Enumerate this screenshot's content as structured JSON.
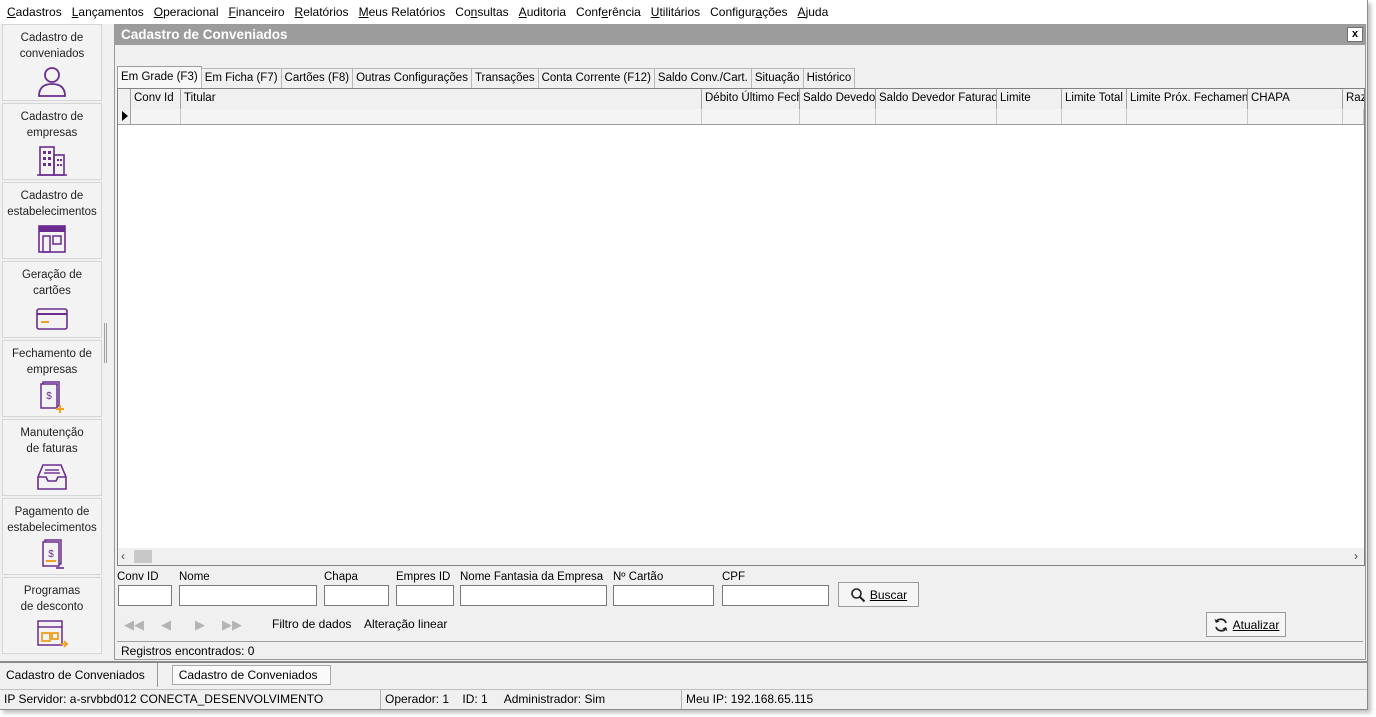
{
  "menu": [
    {
      "label": "Cadastros",
      "u": "C"
    },
    {
      "label": "Lançamentos",
      "u": "L"
    },
    {
      "label": "Operacional",
      "u": "O"
    },
    {
      "label": "Financeiro",
      "u": "F"
    },
    {
      "label": "Relatórios",
      "u": "R"
    },
    {
      "label": "Meus Relatórios",
      "u": "M"
    },
    {
      "label": "Consultas",
      "u": "n"
    },
    {
      "label": "Auditoria",
      "u": "A"
    },
    {
      "label": "Conferência",
      "u": "f"
    },
    {
      "label": "Utilitários",
      "u": "U"
    },
    {
      "label": "Configurações",
      "u": "g"
    },
    {
      "label": "Ajuda",
      "u": "A"
    }
  ],
  "sidebar": {
    "items": [
      {
        "label": "Cadastro de\nconveniados",
        "icon": "user-icon"
      },
      {
        "label": "Cadastro de\nempresas",
        "icon": "building-icon"
      },
      {
        "label": "Cadastro de\nestabelecimentos",
        "icon": "store-icon"
      },
      {
        "label": "Geração de\ncartões",
        "icon": "card-icon"
      },
      {
        "label": "Fechamento de\nempresas",
        "icon": "invoice-plus-icon"
      },
      {
        "label": "Manutenção\nde faturas",
        "icon": "inbox-tray-icon"
      },
      {
        "label": "Pagamento de\nestabelecimentos",
        "icon": "invoice-minus-icon"
      },
      {
        "label": "Programas\nde desconto",
        "icon": "discount-program-icon"
      }
    ]
  },
  "window": {
    "title": "Cadastro de Conveniados",
    "close_label": "x"
  },
  "tabs": [
    "Em Grade (F3)",
    "Em Ficha (F7)",
    "Cartões (F8)",
    "Outras Configurações",
    "Transações",
    "Conta Corrente (F12)",
    "Saldo Conv./Cart.",
    "Situação",
    "Histórico"
  ],
  "grid": {
    "columns": [
      "Conv Id",
      "Titular",
      "Débito Último Fech.",
      "Saldo Devedor",
      "Saldo Devedor Faturado",
      "Limite",
      "Limite Total",
      "Limite Próx. Fechamento",
      "CHAPA",
      "Raz"
    ]
  },
  "filters": {
    "conv_id_label": "Conv ID",
    "nome_label": "Nome",
    "chapa_label": "Chapa",
    "empres_id_label": "Empres ID",
    "nome_fantasia_label": "Nome Fantasia da Empresa",
    "cartao_label": "Nº Cartão",
    "cpf_label": "CPF",
    "conv_id_value": "",
    "nome_value": "",
    "chapa_value": "",
    "empres_id_value": "",
    "nome_fantasia_value": "",
    "cartao_value": "",
    "cpf_value": ""
  },
  "buttons": {
    "buscar": "Buscar",
    "atualizar": "Atualizar",
    "filtro": "Filtro de dados",
    "alteracao": "Alteração linear"
  },
  "status": {
    "registros": "Registros encontrados: 0"
  },
  "window_tabs": [
    "Cadastro de Conveniados",
    "Cadastro de Conveniados"
  ],
  "statusbar": {
    "servidor": "IP Servidor: a-srvbbd012 CONECTA_DESENVOLVIMENTO",
    "operador": "Operador: 1",
    "id": "ID: 1",
    "admin": "Administrador: Sim",
    "meu_ip": "Meu IP: 192.168.65.115"
  },
  "colors": {
    "icon_accent": "#7a3fa0",
    "title_bar": "#9c9c9c"
  }
}
